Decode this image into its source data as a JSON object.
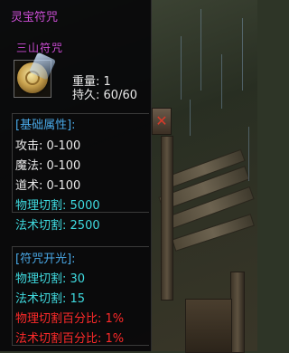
{
  "tooltip": {
    "title": "灵宝符咒",
    "item_name": "三山符咒",
    "item_icon": "amulet-icon",
    "weight_label": "重量:",
    "weight_value": "1",
    "durability_label": "持久:",
    "durability_value": "60/60"
  },
  "base_attributes": {
    "header": "[基础属性]:",
    "lines": [
      {
        "label": "攻击:",
        "value": "0-100",
        "color": "#e8e8e8"
      },
      {
        "label": "魔法:",
        "value": "0-100",
        "color": "#e8e8e8"
      },
      {
        "label": "道术:",
        "value": "0-100",
        "color": "#e8e8e8"
      },
      {
        "label": "物理切割:",
        "value": "5000",
        "color": "#3fdbe0"
      },
      {
        "label": "法术切割:",
        "value": "2500",
        "color": "#3fdbe0"
      }
    ]
  },
  "amulet_attributes": {
    "header": "[符咒开光]:",
    "lines": [
      {
        "label": "物理切割:",
        "value": "30",
        "color": "#3fdbe0"
      },
      {
        "label": "法术切割:",
        "value": "15",
        "color": "#3fdbe0"
      },
      {
        "label": "物理切割百分比:",
        "value": "1%",
        "color": "#ff2a2a"
      },
      {
        "label": "法术切割百分比:",
        "value": "1%",
        "color": "#ff2a2a"
      }
    ]
  },
  "background": {
    "close_icon": "close-icon"
  }
}
